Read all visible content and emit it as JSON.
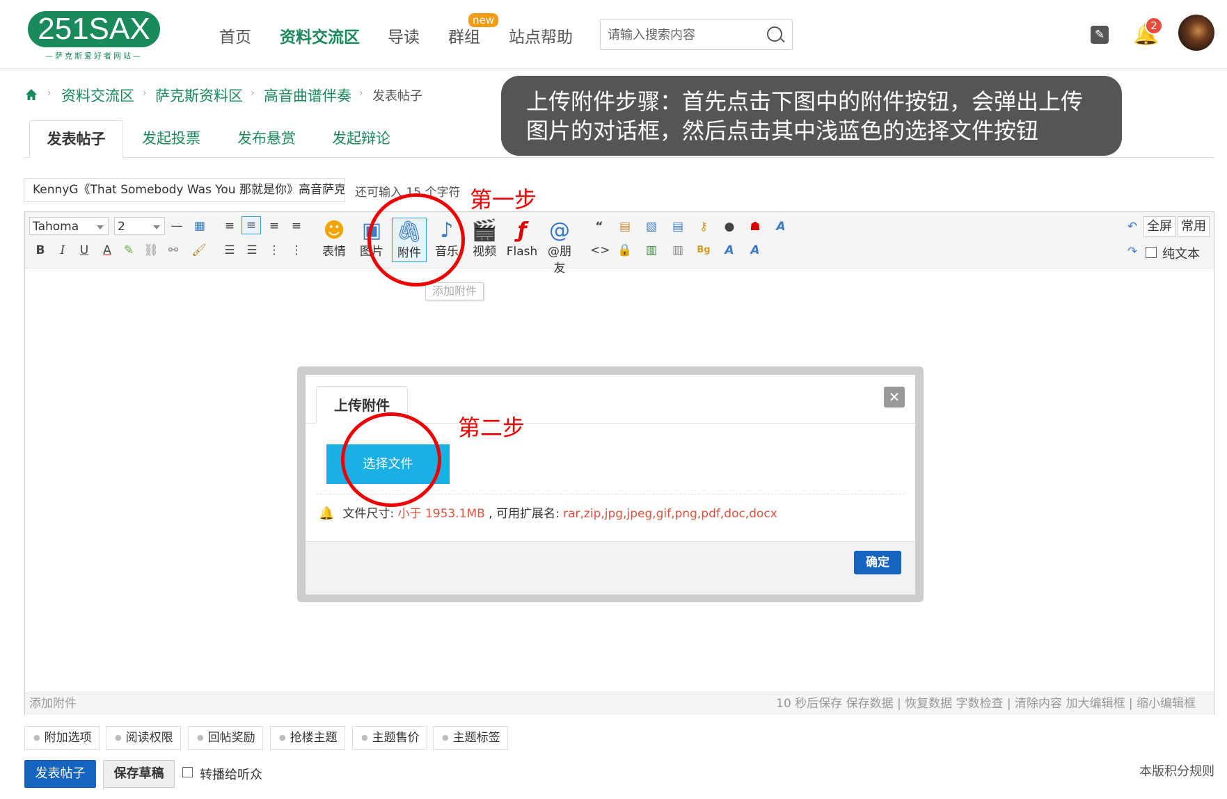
{
  "logo": {
    "text": "251SAX",
    "tagline": "—萨克斯爱好者网站—"
  },
  "nav": {
    "items": [
      "首页",
      "资料交流区",
      "导读",
      "群组",
      "站点帮助"
    ],
    "active": "资料交流区",
    "new_badge": "new"
  },
  "search": {
    "placeholder": "请输入搜索内容"
  },
  "notifications": {
    "count": "2"
  },
  "breadcrumb": [
    "资料交流区",
    "萨克斯资料区",
    "高音曲谱伴奏",
    "发表帖子"
  ],
  "callout": {
    "line1": "上传附件步骤：首先点击下图中的附件按钮，会弹出上传",
    "line2": "图片的对话框，然后点击其中浅蓝色的选择文件按钮"
  },
  "tabs": [
    "发表帖子",
    "发起投票",
    "发布悬赏",
    "发起辩论"
  ],
  "subject": {
    "value": "KennyG《That Somebody Was You 那就是你》高音萨克",
    "remaining": "还可输入 15 个字符"
  },
  "steps": {
    "one": "第一步",
    "two": "第二步"
  },
  "toolbar": {
    "font": "Tahoma",
    "size": "2",
    "buttons": [
      {
        "label": "表情",
        "icon": "smile-icon"
      },
      {
        "label": "图片",
        "icon": "image-icon"
      },
      {
        "label": "附件",
        "icon": "paperclip-icon"
      },
      {
        "label": "音乐",
        "icon": "music-icon"
      },
      {
        "label": "视频",
        "icon": "video-icon"
      },
      {
        "label": "Flash",
        "icon": "flash-icon"
      },
      {
        "label": "@朋友",
        "icon": "at-icon"
      }
    ],
    "fullscreen": "全屏",
    "common": "常用",
    "plain_text": "纯文本",
    "tooltip": "添加附件"
  },
  "editor_footer": {
    "left": "添加附件",
    "right": "10 秒后保存 保存数据 | 恢复数据    字数检查 | 清除内容    加大编辑框 | 缩小编辑框"
  },
  "modal": {
    "tab": "上传附件",
    "choose_file": "选择文件",
    "info_prefix": "文件尺寸: ",
    "size_limit": "小于 1953.1MB",
    "ext_prefix": " , 可用扩展名: ",
    "extensions": "rar,zip,jpg,jpeg,gif,png,pdf,doc,docx",
    "ok": "确定"
  },
  "options": [
    "附加选项",
    "阅读权限",
    "回帖奖励",
    "抢楼主题",
    "主题售价",
    "主题标签"
  ],
  "actions": {
    "submit": "发表帖子",
    "draft": "保存草稿",
    "broadcast": "转播给听众",
    "rules": "本版积分规则"
  },
  "colors": {
    "brand_green": "#1b8a5a",
    "primary_blue": "#1565c0",
    "choose_blue": "#1ab0e6",
    "annotation_red": "#ee0000"
  }
}
